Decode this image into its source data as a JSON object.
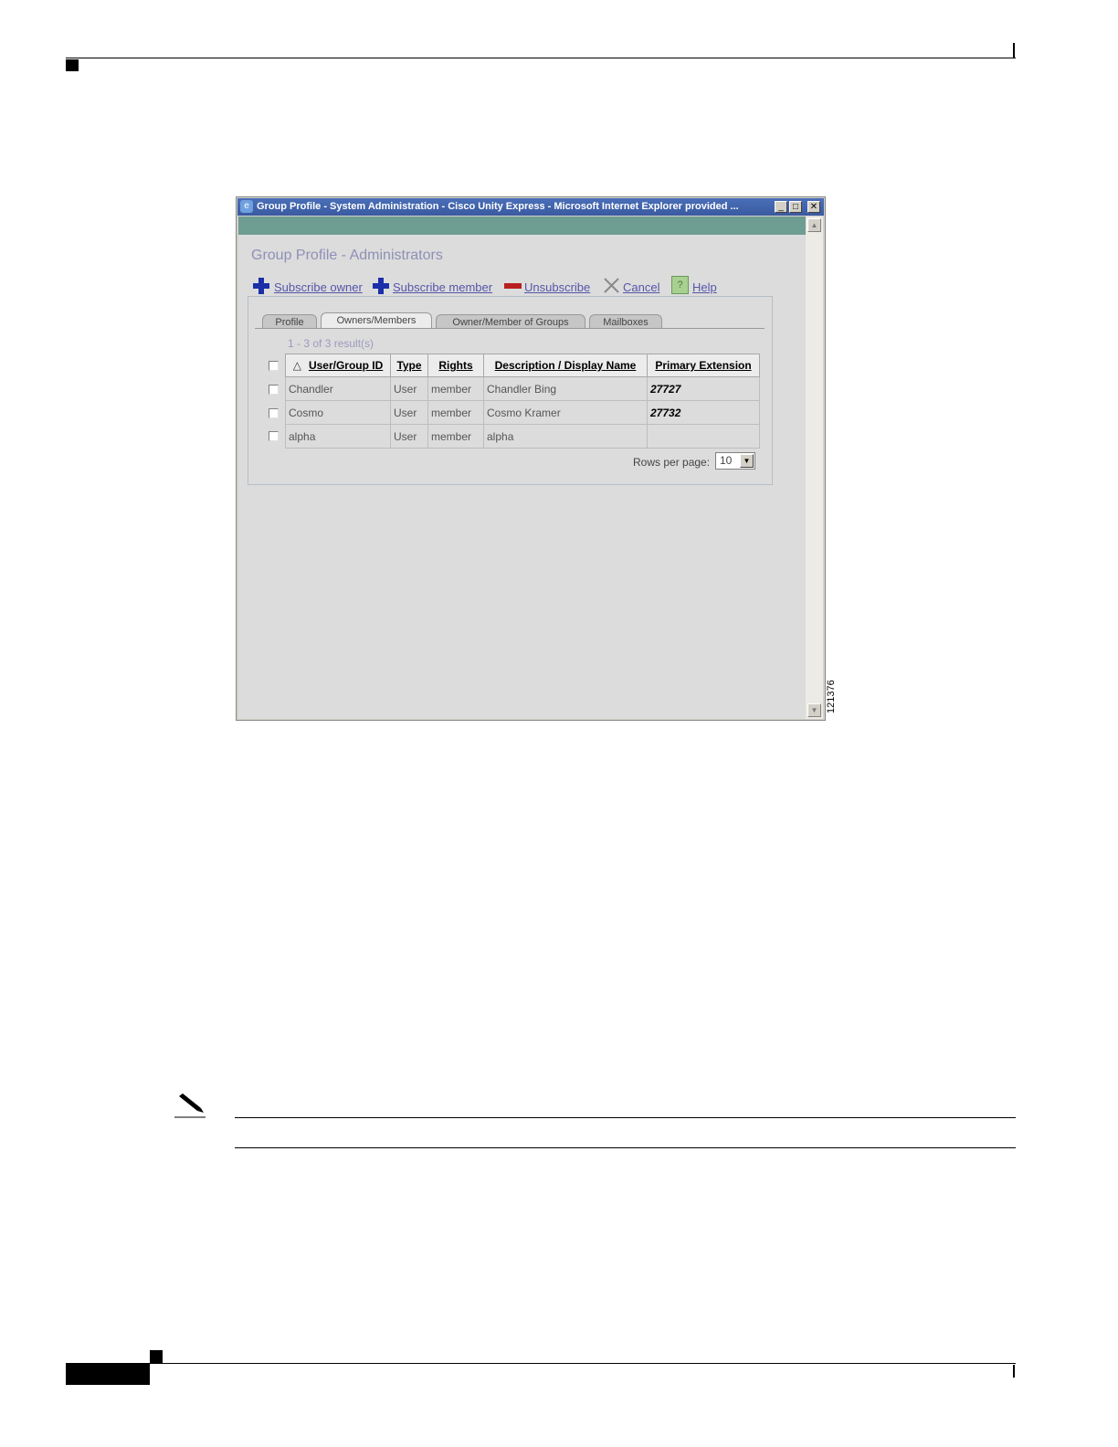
{
  "window": {
    "title": "Group Profile - System Administration - Cisco Unity Express - Microsoft Internet Explorer provided ...",
    "buttons": {
      "minimize": "_",
      "maximize": "□",
      "close": "✕"
    }
  },
  "page": {
    "title": "Group Profile - Administrators"
  },
  "toolbar": {
    "subscribe_owner": "Subscribe owner",
    "subscribe_member": "Subscribe member",
    "unsubscribe": "Unsubscribe",
    "cancel": "Cancel",
    "help": "Help",
    "icons": [
      "plus-icon",
      "plus-icon",
      "minus-icon",
      "cancel-x-icon",
      "help-icon"
    ]
  },
  "tabs": [
    {
      "label": "Profile",
      "active": false
    },
    {
      "label": "Owners/Members",
      "active": true
    },
    {
      "label": "Owner/Member of Groups",
      "active": false
    },
    {
      "label": "Mailboxes",
      "active": false
    }
  ],
  "results": "1 - 3 of 3 result(s)",
  "table": {
    "sort_indicator": "△",
    "columns": [
      "User/Group ID",
      "Type",
      "Rights",
      "Description / Display Name",
      "Primary Extension"
    ],
    "rows": [
      {
        "id": "Chandler",
        "type": "User",
        "rights": "member",
        "name": "Chandler Bing",
        "ext": "27727"
      },
      {
        "id": "Cosmo",
        "type": "User",
        "rights": "member",
        "name": "Cosmo Kramer",
        "ext": "27732"
      },
      {
        "id": "alpha",
        "type": "User",
        "rights": "member",
        "name": "alpha",
        "ext": ""
      }
    ]
  },
  "pagination": {
    "rows_per_page_label": "Rows per page:",
    "rows_per_page_value": "10"
  },
  "figure_id": "121376",
  "colors": {
    "teal_bar": "#6e9d92",
    "title_text": "#8f8fb8",
    "link": "#5555aa",
    "plus": "#1a2fa8",
    "minus": "#b82020"
  }
}
